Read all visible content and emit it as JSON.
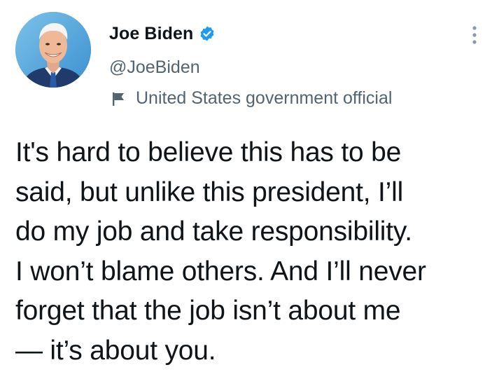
{
  "author": {
    "display_name": "Joe Biden",
    "handle": "@JoeBiden",
    "label": "United States government official",
    "verified": true,
    "avatar_icon": "profile-photo"
  },
  "tweet": {
    "text": "It's hard to believe this has to be\nsaid, but unlike this president, I’ll\ndo my job and take responsibility.\nI won’t blame others. And I’ll never\nforget that the job isn’t about me\n— it’s about you."
  },
  "colors": {
    "verified_blue": "#1d9bf0",
    "secondary_text": "#536471",
    "primary_text": "#0f1419",
    "avatar_background": "#4fa6da"
  },
  "icons": {
    "verified": "verified-badge-icon",
    "label": "flag-icon",
    "more": "more-vertical-icon"
  }
}
